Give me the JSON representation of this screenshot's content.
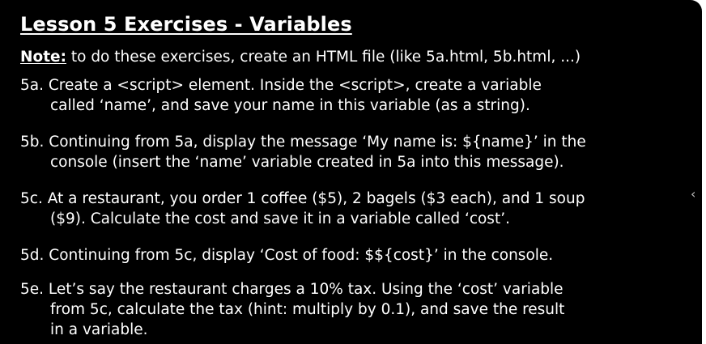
{
  "title": "Lesson 5 Exercises - Variables",
  "note": {
    "label": "Note:",
    "text": " to do these exercises, create an HTML file (like 5a.html, 5b.html, ...)"
  },
  "exercises": [
    {
      "lines": [
        "5a. Create a <script> element. Inside the <script>, create a variable",
        "called ‘name’, and save your name in this variable (as a string)."
      ]
    },
    {
      "lines": [
        "5b. Continuing from 5a, display the message ‘My name is: ${name}’ in the",
        "console (insert the ‘name’ variable created in 5a into this message)."
      ]
    },
    {
      "lines": [
        "5c. At a restaurant, you order 1 coffee ($5), 2 bagels ($3 each), and 1 soup",
        "($9). Calculate the cost and save it in a variable called ‘cost’."
      ]
    },
    {
      "lines": [
        "5d. Continuing from 5c, display ‘Cost of food: $${cost}’ in the console."
      ]
    },
    {
      "lines": [
        "5e. Let’s say the restaurant charges a 10% tax. Using the ‘cost’ variable",
        "from 5c, calculate the tax (hint: multiply by 0.1), and save the result",
        "in a variable."
      ]
    }
  ],
  "nav": {
    "prev_icon": "‹"
  }
}
